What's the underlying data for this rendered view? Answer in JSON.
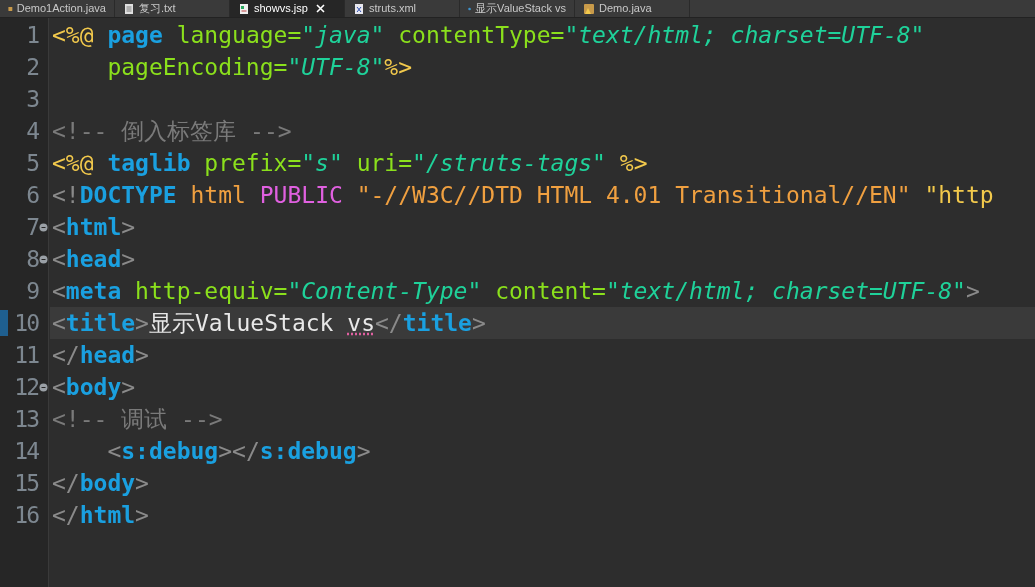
{
  "tabs": [
    {
      "label": "Demo1Action.java",
      "kind": "java",
      "selected": false
    },
    {
      "label": "复习.txt",
      "kind": "text",
      "selected": false
    },
    {
      "label": "showvs.jsp",
      "kind": "jsp",
      "selected": true
    },
    {
      "label": "struts.xml",
      "kind": "xml",
      "selected": false
    },
    {
      "label": "显示ValueStack vs",
      "kind": "web",
      "selected": false
    },
    {
      "label": "Demo.java",
      "kind": "java-warning",
      "selected": false
    }
  ],
  "editor": {
    "lines": [
      {
        "number": "1",
        "current": false,
        "foldable": false,
        "tokens": [
          {
            "kind": "directive",
            "text": "<%@"
          },
          {
            "kind": "tag",
            "text": " page"
          },
          {
            "kind": "attr",
            "text": " language="
          },
          {
            "kind": "string",
            "text": "\"java\""
          },
          {
            "kind": "attr",
            "text": " contentType="
          },
          {
            "kind": "string",
            "text": "\"text/html; charset=UTF-8\""
          }
        ]
      },
      {
        "number": "2",
        "current": false,
        "foldable": false,
        "tokens": [
          {
            "kind": "attr",
            "text": "    pageEncoding="
          },
          {
            "kind": "string",
            "text": "\"UTF-8\""
          },
          {
            "kind": "directive",
            "text": "%>"
          }
        ]
      },
      {
        "number": "3",
        "current": false,
        "foldable": false
      },
      {
        "number": "4",
        "current": false,
        "foldable": false,
        "tokens": [
          {
            "kind": "comment",
            "text": "<!-- 倒入标签库 -->"
          }
        ]
      },
      {
        "number": "5",
        "current": false,
        "foldable": false,
        "tokens": [
          {
            "kind": "directive",
            "text": "<%@"
          },
          {
            "kind": "tag",
            "text": " taglib"
          },
          {
            "kind": "attr",
            "text": " prefix="
          },
          {
            "kind": "string",
            "text": "\"s\""
          },
          {
            "kind": "attr",
            "text": " uri="
          },
          {
            "kind": "string",
            "text": "\"/struts-tags\""
          },
          {
            "kind": "directive",
            "text": " %>"
          }
        ]
      },
      {
        "number": "6",
        "current": false,
        "foldable": false,
        "tokens": [
          {
            "kind": "bracket",
            "text": "<!"
          },
          {
            "kind": "tag",
            "text": "DOCTYPE"
          },
          {
            "kind": "doctype",
            "text": " html"
          },
          {
            "kind": "public",
            "text": " PUBLIC"
          },
          {
            "kind": "doctype",
            "text": " \"-//W3C//DTD HTML 4.01 Transitional//EN\""
          },
          {
            "kind": "directive",
            "text": " \"http"
          }
        ]
      },
      {
        "number": "7",
        "current": false,
        "foldable": true,
        "tokens": [
          {
            "kind": "bracket",
            "text": "<"
          },
          {
            "kind": "tag",
            "text": "html"
          },
          {
            "kind": "bracket",
            "text": ">"
          }
        ]
      },
      {
        "number": "8",
        "current": false,
        "foldable": true,
        "tokens": [
          {
            "kind": "bracket",
            "text": "<"
          },
          {
            "kind": "tag",
            "text": "head"
          },
          {
            "kind": "bracket",
            "text": ">"
          }
        ]
      },
      {
        "number": "9",
        "current": false,
        "foldable": false,
        "tokens": [
          {
            "kind": "bracket",
            "text": "<"
          },
          {
            "kind": "tag",
            "text": "meta"
          },
          {
            "kind": "attr",
            "text": " http-equiv="
          },
          {
            "kind": "string",
            "text": "\"Content-Type\""
          },
          {
            "kind": "attr",
            "text": " content="
          },
          {
            "kind": "string",
            "text": "\"text/html; charset=UTF-8\""
          },
          {
            "kind": "bracket",
            "text": ">"
          }
        ]
      },
      {
        "number": "10",
        "current": true,
        "foldable": false,
        "tokens": [
          {
            "kind": "bracket",
            "text": "<"
          },
          {
            "kind": "tag",
            "text": "title"
          },
          {
            "kind": "bracket",
            "text": ">"
          },
          {
            "kind": "plain",
            "text": "显示ValueStack "
          },
          {
            "kind": "misspelled",
            "text": "vs"
          },
          {
            "kind": "bracket",
            "text": "</"
          },
          {
            "kind": "tag",
            "text": "title"
          },
          {
            "kind": "bracket",
            "text": ">"
          }
        ]
      },
      {
        "number": "11",
        "current": false,
        "foldable": false,
        "tokens": [
          {
            "kind": "bracket",
            "text": "</"
          },
          {
            "kind": "tag",
            "text": "head"
          },
          {
            "kind": "bracket",
            "text": ">"
          }
        ]
      },
      {
        "number": "12",
        "current": false,
        "foldable": true,
        "tokens": [
          {
            "kind": "bracket",
            "text": "<"
          },
          {
            "kind": "tag",
            "text": "body"
          },
          {
            "kind": "bracket",
            "text": ">"
          }
        ]
      },
      {
        "number": "13",
        "current": false,
        "foldable": false,
        "tokens": [
          {
            "kind": "comment",
            "text": "<!-- 调试 -->"
          }
        ]
      },
      {
        "number": "14",
        "current": false,
        "foldable": false,
        "tokens": [
          {
            "kind": "bracket",
            "text": "    <"
          },
          {
            "kind": "tag",
            "text": "s:debug"
          },
          {
            "kind": "bracket",
            "text": "></"
          },
          {
            "kind": "tag",
            "text": "s:debug"
          },
          {
            "kind": "bracket",
            "text": ">"
          }
        ]
      },
      {
        "number": "15",
        "current": false,
        "foldable": false,
        "tokens": [
          {
            "kind": "bracket",
            "text": "</"
          },
          {
            "kind": "tag",
            "text": "body"
          },
          {
            "kind": "bracket",
            "text": ">"
          }
        ]
      },
      {
        "number": "16",
        "current": false,
        "foldable": false,
        "tokens": [
          {
            "kind": "bracket",
            "text": "</"
          },
          {
            "kind": "tag",
            "text": "html"
          },
          {
            "kind": "bracket",
            "text": ">"
          }
        ]
      }
    ]
  }
}
